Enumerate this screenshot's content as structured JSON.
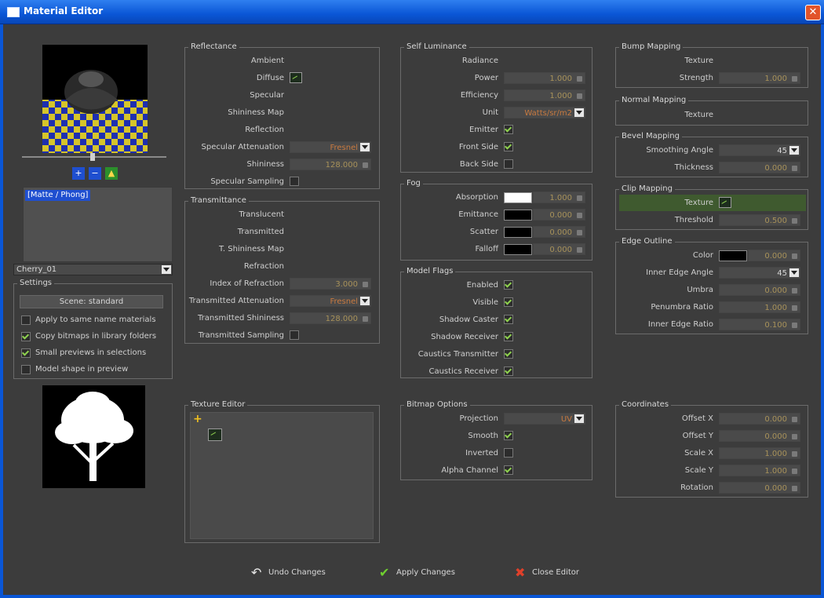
{
  "window": {
    "title": "Material Editor",
    "close_glyph": "✕"
  },
  "left": {
    "material_list": [
      "[Matte / Phong]"
    ],
    "material_name": "Cherry_01",
    "settings_title": "Settings",
    "scene_button": "Scene: standard",
    "options": [
      {
        "label": "Apply to same name materials",
        "checked": false
      },
      {
        "label": "Copy bitmaps in library folders",
        "checked": true
      },
      {
        "label": "Small previews in selections",
        "checked": true
      },
      {
        "label": "Model shape in preview",
        "checked": false
      }
    ],
    "tool_icons": [
      "zoom-in-icon",
      "zoom-out-icon",
      "load-icon"
    ]
  },
  "reflectance": {
    "title": "Reflectance",
    "ambient": "Ambient",
    "diffuse": "Diffuse",
    "specular": "Specular",
    "shininess_map": "Shininess Map",
    "reflection": "Reflection",
    "spec_atten_label": "Specular Attenuation",
    "spec_atten_value": "Fresnel",
    "shininess_label": "Shininess",
    "shininess_value": "128.000",
    "spec_sampling": "Specular Sampling"
  },
  "transmittance": {
    "title": "Transmittance",
    "translucent": "Translucent",
    "transmitted": "Transmitted",
    "t_shininess_map": "T. Shininess Map",
    "refraction": "Refraction",
    "ior_label": "Index of Refraction",
    "ior_value": "3.000",
    "atten_label": "Transmitted Attenuation",
    "atten_value": "Fresnel",
    "shininess_label": "Transmitted Shininess",
    "shininess_value": "128.000",
    "sampling": "Transmitted Sampling"
  },
  "self_luminance": {
    "title": "Self Luminance",
    "radiance": "Radiance",
    "power_label": "Power",
    "power_value": "1.000",
    "efficiency_label": "Efficiency",
    "efficiency_value": "1.000",
    "unit_label": "Unit",
    "unit_value": "Watts/sr/m2",
    "emitter": "Emitter",
    "front_side": "Front Side",
    "back_side": "Back Side"
  },
  "fog": {
    "title": "Fog",
    "absorption": "Absorption",
    "absorption_value": "1.000",
    "emittance": "Emittance",
    "emittance_value": "0.000",
    "scatter": "Scatter",
    "scatter_value": "0.000",
    "falloff": "Falloff",
    "falloff_value": "0.000"
  },
  "model_flags": {
    "title": "Model Flags",
    "items": [
      "Enabled",
      "Visible",
      "Shadow Caster",
      "Shadow Receiver",
      "Caustics Transmitter",
      "Caustics Receiver"
    ]
  },
  "bump": {
    "title": "Bump Mapping",
    "texture": "Texture",
    "strength_label": "Strength",
    "strength_value": "1.000"
  },
  "normal": {
    "title": "Normal Mapping",
    "texture": "Texture"
  },
  "bevel": {
    "title": "Bevel Mapping",
    "smoothing_label": "Smoothing Angle",
    "smoothing_value": "45",
    "thickness_label": "Thickness",
    "thickness_value": "0.000"
  },
  "clip": {
    "title": "Clip Mapping",
    "texture": "Texture",
    "threshold_label": "Threshold",
    "threshold_value": "0.500"
  },
  "edge": {
    "title": "Edge Outline",
    "color_label": "Color",
    "color_value": "0.000",
    "inner_angle_label": "Inner Edge Angle",
    "inner_angle_value": "45",
    "umbra_label": "Umbra",
    "umbra_value": "0.000",
    "penumbra_label": "Penumbra Ratio",
    "penumbra_value": "1.000",
    "inner_ratio_label": "Inner Edge Ratio",
    "inner_ratio_value": "0.100"
  },
  "texture_editor": {
    "title": "Texture Editor"
  },
  "bitmap_options": {
    "title": "Bitmap Options",
    "projection_label": "Projection",
    "projection_value": "UV",
    "smooth": "Smooth",
    "inverted": "Inverted",
    "alpha": "Alpha Channel"
  },
  "coordinates": {
    "title": "Coordinates",
    "offset_x": "Offset X",
    "offset_x_value": "0.000",
    "offset_y": "Offset Y",
    "offset_y_value": "0.000",
    "scale_x": "Scale X",
    "scale_x_value": "1.000",
    "scale_y": "Scale Y",
    "scale_y_value": "1.000",
    "rotation": "Rotation",
    "rotation_value": "0.000"
  },
  "buttons": {
    "undo": "Undo Changes",
    "apply": "Apply Changes",
    "close": "Close Editor"
  },
  "colors": {
    "titlebar": "#0a56d6",
    "panel_bg": "#3c3c3c",
    "value_text": "#a8925a",
    "check_green": "#8fd14f",
    "selection_blue": "#1f4fd0"
  }
}
